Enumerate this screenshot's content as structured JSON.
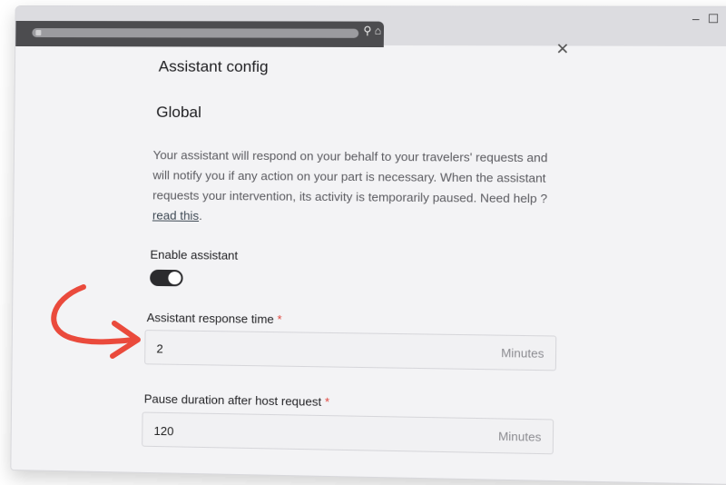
{
  "modal": {
    "title": "Assistant config",
    "section": "Global",
    "description_text": "Your assistant will respond on your behalf to your travelers' requests and will notify you if any action on your part is necessary. When the assistant requests your intervention, its activity is temporarily paused. Need help ?",
    "help_link": "read this",
    "help_suffix": ".",
    "close_glyph": "✕"
  },
  "enable": {
    "label": "Enable assistant",
    "on": true
  },
  "response_time": {
    "label": "Assistant response time",
    "required": "*",
    "value": "2",
    "unit": "Minutes"
  },
  "pause_duration": {
    "label": "Pause duration after host request",
    "required": "*",
    "value": "120",
    "unit": "Minutes"
  },
  "window_controls": {
    "minimize": "–",
    "maximize": "☐",
    "close": "✕"
  },
  "colors": {
    "annotation_arrow": "#ea4a3c",
    "toggle_track": "#2b2b2e"
  }
}
